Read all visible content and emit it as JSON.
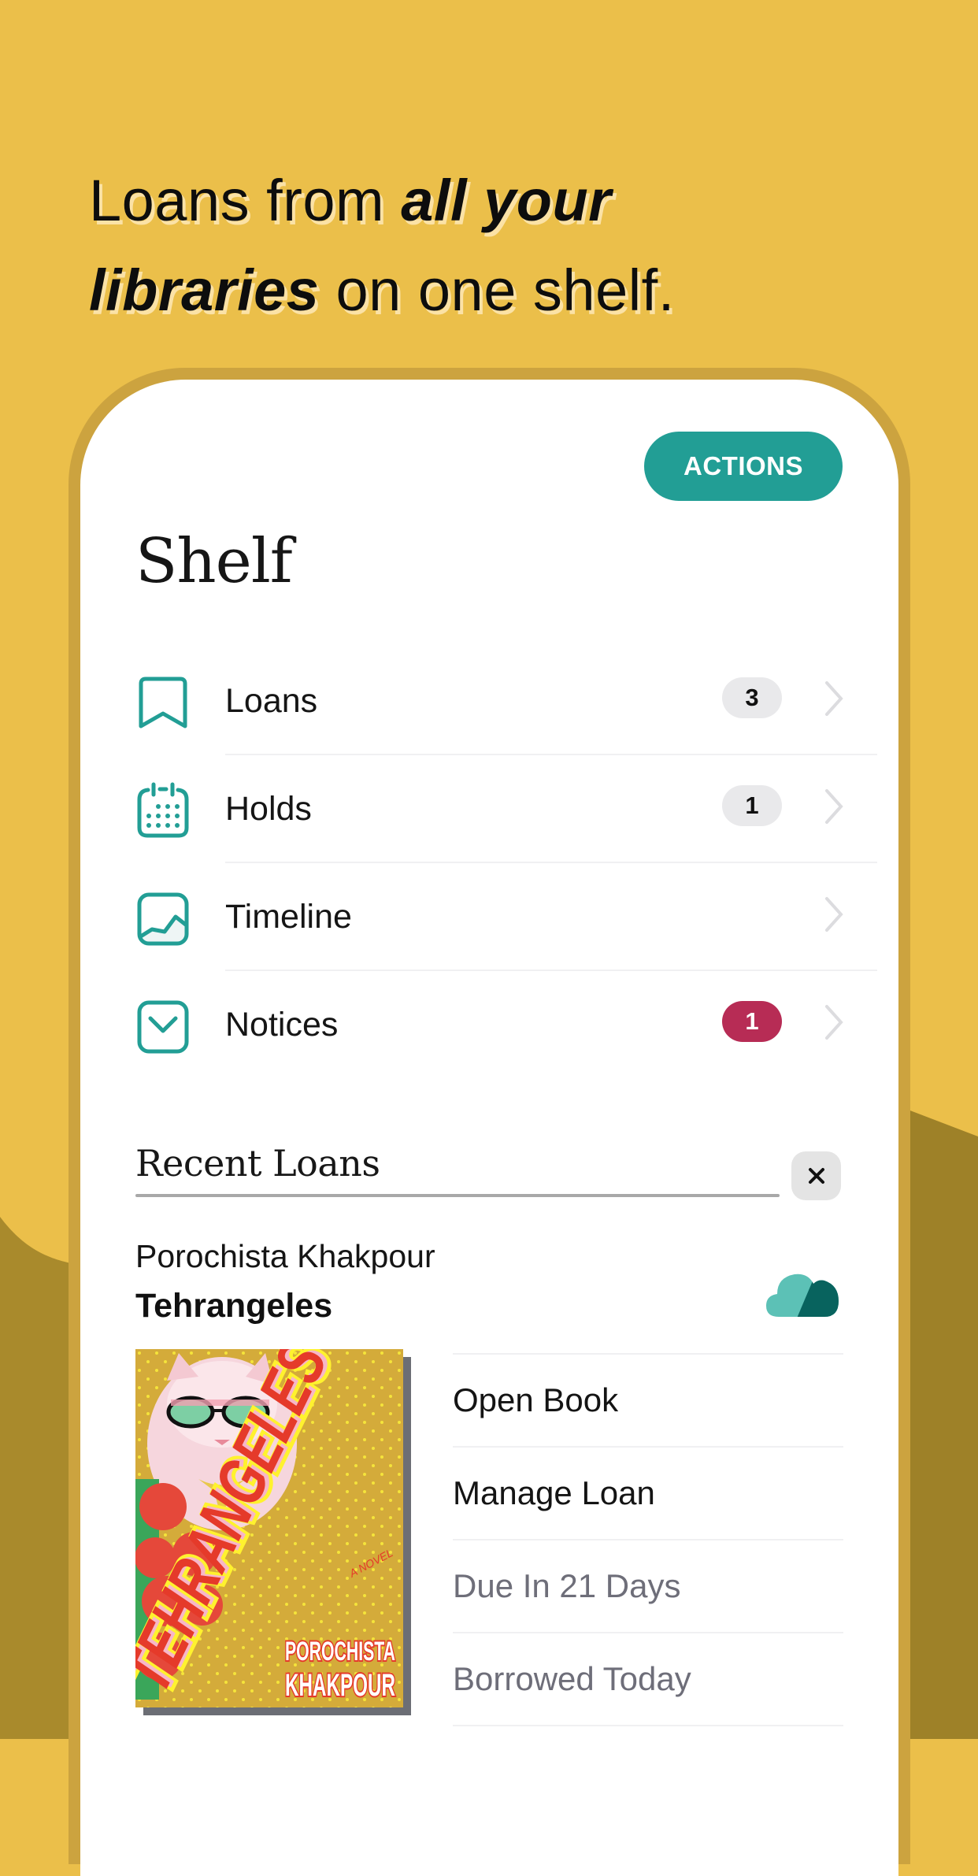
{
  "headline": {
    "part1": "Loans from ",
    "emphasis1": "all your",
    "emphasis2": "libraries",
    "part2": " on one shelf."
  },
  "colors": {
    "background": "#ebbf4a",
    "background_dark": "#a2842b",
    "phone_frame": "#cca33f",
    "accent": "#229e95",
    "alert": "#b72c55",
    "badge_gray": "#e9e9eb"
  },
  "screen": {
    "actions_button": "ACTIONS",
    "title": "Shelf",
    "nav": [
      {
        "label": "Loans",
        "icon": "bookmark-icon",
        "badge": "3",
        "badge_style": "neutral"
      },
      {
        "label": "Holds",
        "icon": "calendar-icon",
        "badge": "1",
        "badge_style": "neutral"
      },
      {
        "label": "Timeline",
        "icon": "chart-icon",
        "badge": null,
        "badge_style": null
      },
      {
        "label": "Notices",
        "icon": "envelope-icon",
        "badge": "1",
        "badge_style": "alert"
      }
    ],
    "recent_loans": {
      "heading": "Recent Loans",
      "close_icon": "close-icon",
      "item": {
        "author": "Porochista Khakpour",
        "title": "Tehrangeles",
        "status_icon": "cloud-download-icon",
        "cover": {
          "title_text": "TEHRANGELES",
          "subtitle_text": "A NOVEL",
          "author_line1": "POROCHISTA",
          "author_line2": "KHAKPOUR"
        },
        "actions": [
          {
            "label": "Open Book",
            "muted": false
          },
          {
            "label": "Manage Loan",
            "muted": false
          },
          {
            "label": "Due In 21 Days",
            "muted": true
          },
          {
            "label": "Borrowed Today",
            "muted": true
          }
        ]
      }
    }
  }
}
